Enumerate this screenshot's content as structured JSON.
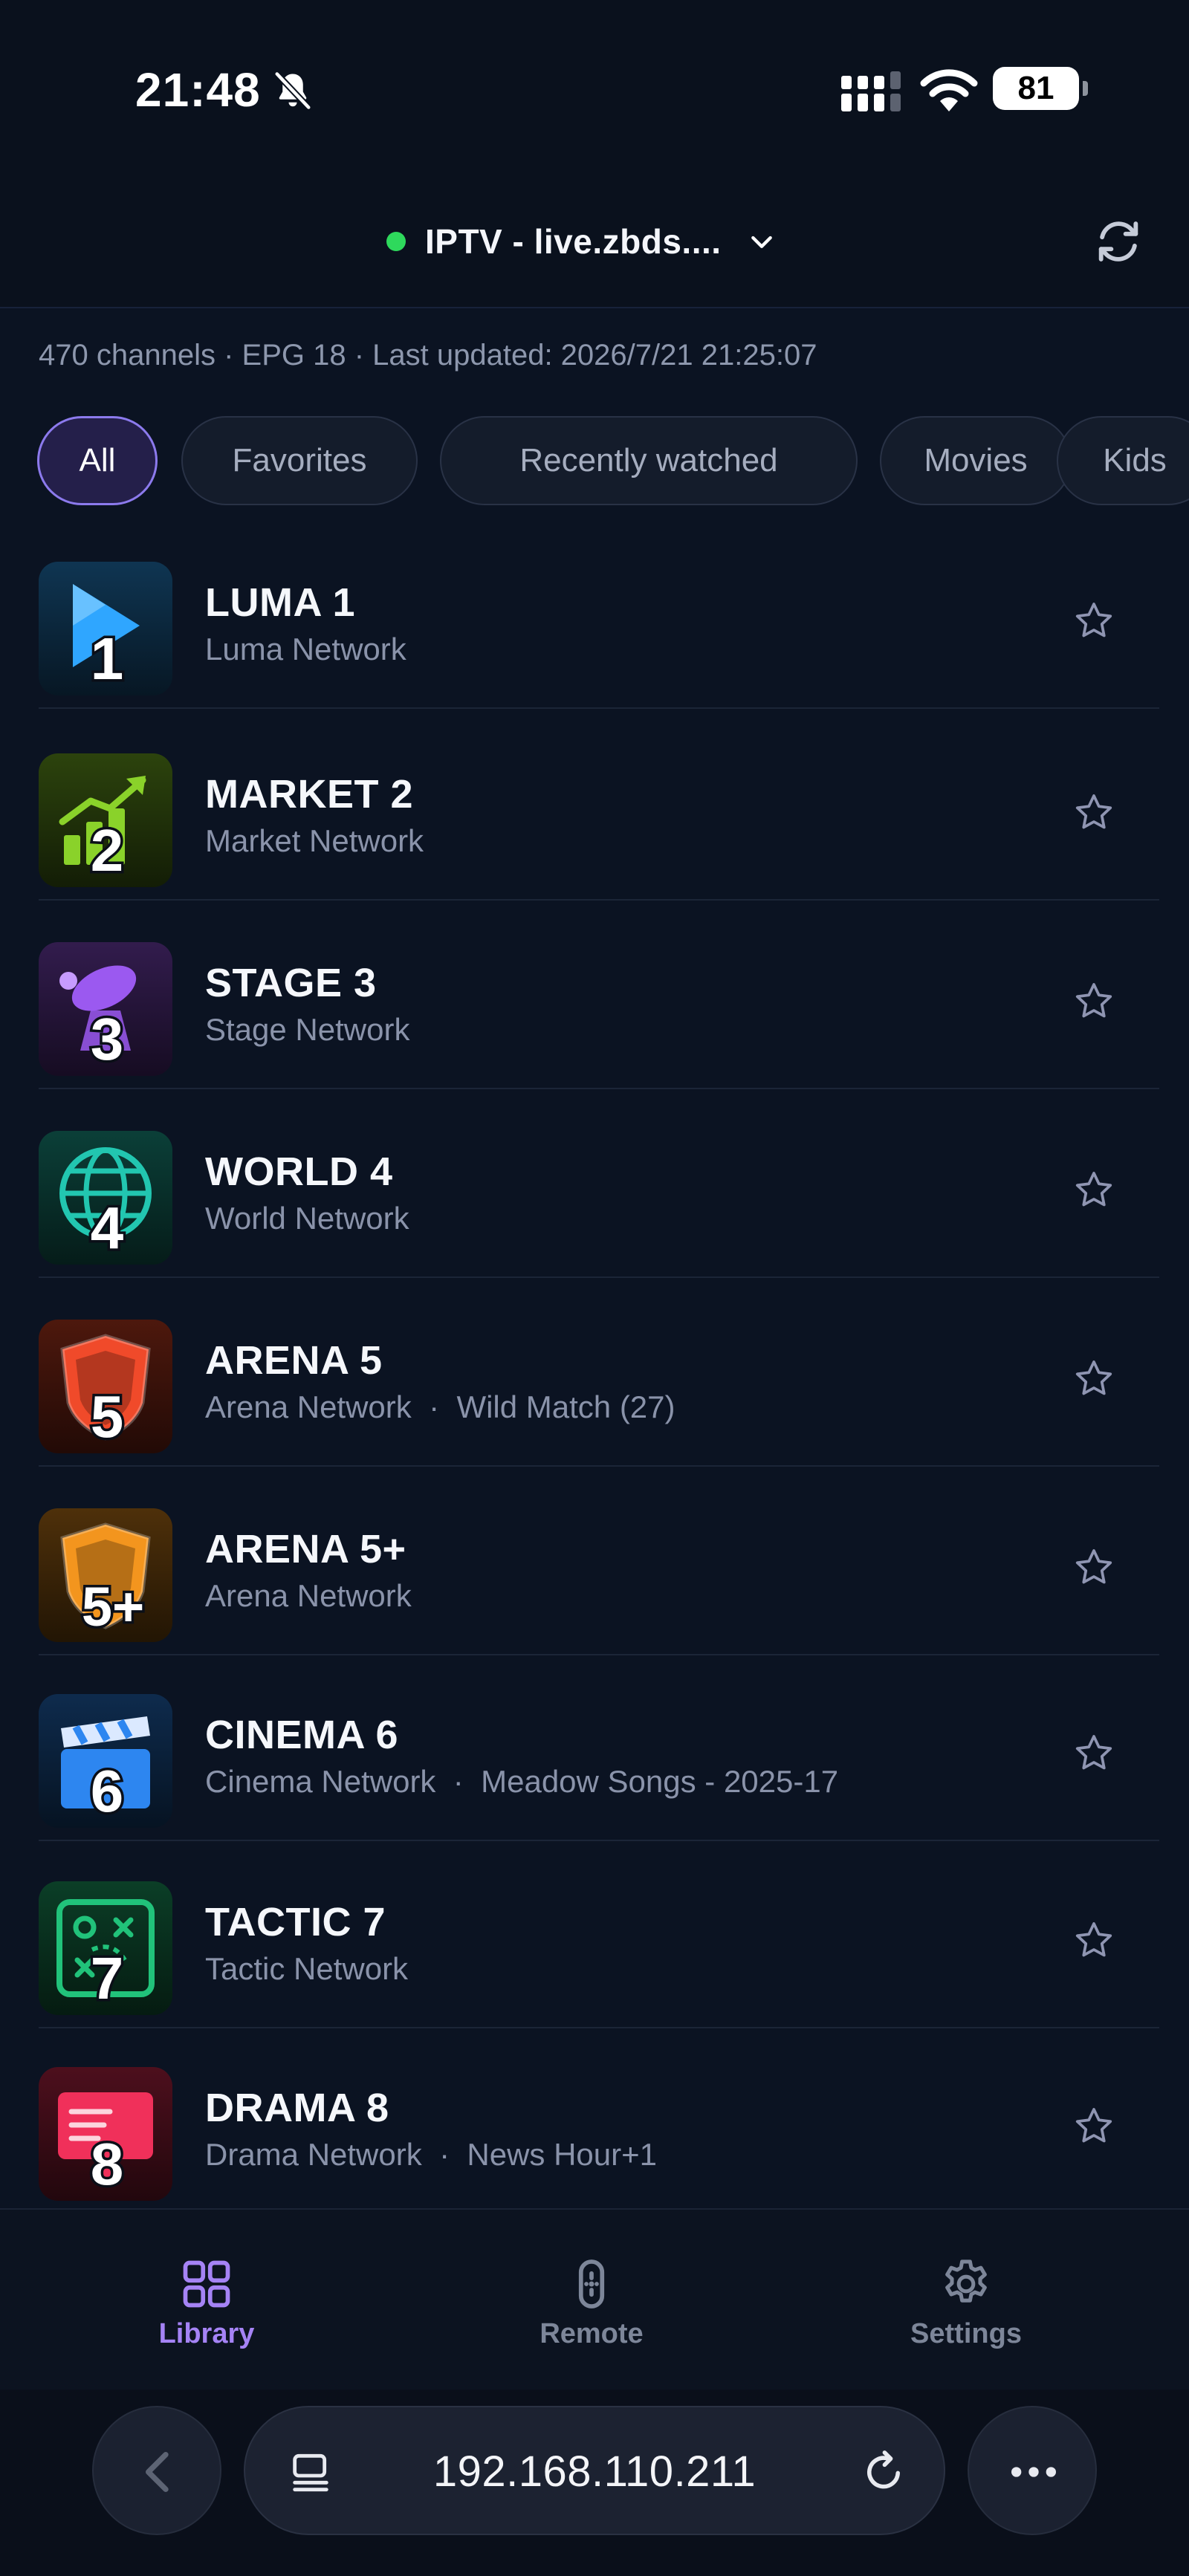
{
  "status_bar": {
    "time": "21:48",
    "battery": "81"
  },
  "header": {
    "server_name": "IPTV - live.zbds....",
    "connection_color": "#2ed95c"
  },
  "info": "470 channels · EPG 18 · Last updated: 2026/7/21 21:25:07",
  "filters": [
    {
      "label": "All",
      "active": true
    },
    {
      "label": "Favorites"
    },
    {
      "label": "Recently watched"
    },
    {
      "label": "Movies"
    },
    {
      "label": "Kids"
    }
  ],
  "channels": [
    {
      "number": "1",
      "name": "LUMA 1",
      "network": "Luma Network",
      "program": "",
      "icon": "play-icon",
      "color": "#2fa6ff"
    },
    {
      "number": "2",
      "name": "MARKET 2",
      "network": "Market Network",
      "program": "",
      "icon": "trend-chart-icon",
      "color": "#8ad22a"
    },
    {
      "number": "3",
      "name": "STAGE 3",
      "network": "Stage Network",
      "program": "",
      "icon": "spotlight-icon",
      "color": "#9b59f0"
    },
    {
      "number": "4",
      "name": "WORLD 4",
      "network": "World Network",
      "program": "",
      "icon": "globe-icon",
      "color": "#22c6b0"
    },
    {
      "number": "5",
      "name": "ARENA 5",
      "network": "Arena Network",
      "program": "Wild Match (27)",
      "icon": "shield-icon",
      "color": "#f04a2a"
    },
    {
      "number": "5+",
      "name": "ARENA 5+",
      "network": "Arena Network",
      "program": "",
      "icon": "shield-icon",
      "color": "#f3951e"
    },
    {
      "number": "6",
      "name": "CINEMA 6",
      "network": "Cinema Network",
      "program": "Meadow Songs - 2025-17",
      "icon": "clapperboard-icon",
      "color": "#2d86f0"
    },
    {
      "number": "7",
      "name": "TACTIC 7",
      "network": "Tactic Network",
      "program": "",
      "icon": "tactics-board-icon",
      "color": "#21c27a"
    },
    {
      "number": "8",
      "name": "DRAMA 8",
      "network": "Drama Network",
      "program": "News Hour+1",
      "icon": "monitor-icon",
      "color": "#f0305a"
    }
  ],
  "tabs": [
    {
      "label": "Library",
      "icon": "grid-icon",
      "active": true
    },
    {
      "label": "Remote",
      "icon": "remote-icon"
    },
    {
      "label": "Settings",
      "icon": "gear-icon"
    }
  ],
  "browser": {
    "url": "192.168.110.211"
  },
  "colors": {
    "accent": "#8c7aed",
    "background": "#0b1322"
  }
}
